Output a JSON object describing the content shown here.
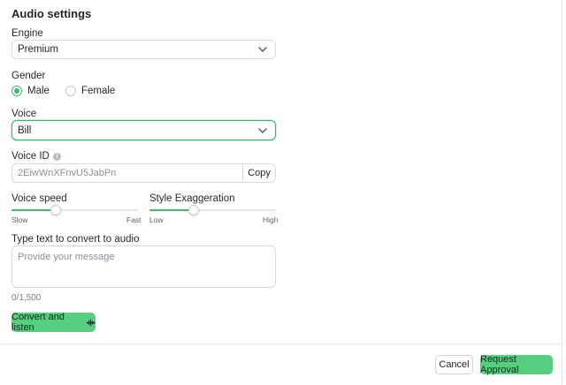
{
  "section_title": "Audio settings",
  "engine": {
    "label": "Engine",
    "value": "Premium"
  },
  "gender": {
    "label": "Gender",
    "options": [
      {
        "label": "Male",
        "selected": true
      },
      {
        "label": "Female",
        "selected": false
      }
    ]
  },
  "voice": {
    "label": "Voice",
    "value": "Bill"
  },
  "voice_id": {
    "label": "Voice ID",
    "value": "2EiwWnXFnvU5JabPn",
    "copy_label": "Copy"
  },
  "voice_speed": {
    "label": "Voice speed",
    "min_label": "Slow",
    "max_label": "Fast",
    "level": 0.35
  },
  "style_exaggeration": {
    "label": "Style Exaggeration",
    "min_label": "Low",
    "max_label": "High",
    "level": 0.35
  },
  "text_input": {
    "label": "Type text to convert to audio",
    "placeholder": "Provide your message",
    "counter": "0/1,500"
  },
  "convert_button": {
    "label": "Convert and listen"
  },
  "footer": {
    "cancel_label": "Cancel",
    "approve_label": "Request Approval"
  },
  "colors": {
    "accent": "#56cf81",
    "accent_border": "#37b866"
  }
}
